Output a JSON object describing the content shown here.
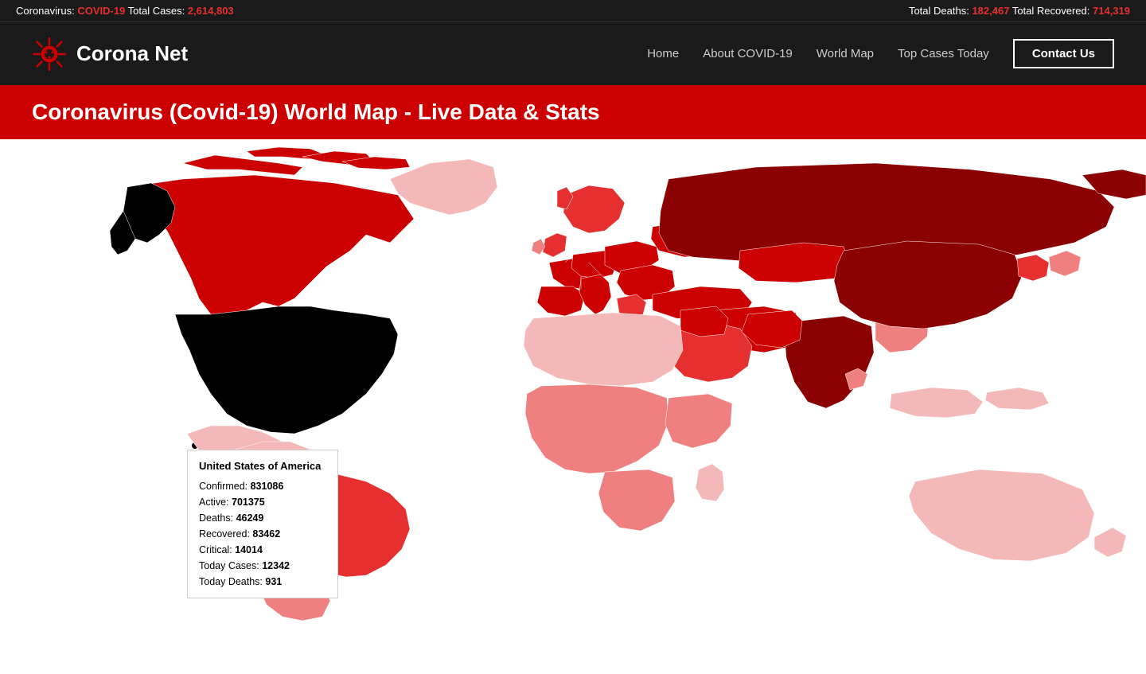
{
  "ticker": {
    "left": "Coronavirus: ",
    "covid_label": "COVID-19",
    "total_cases_label": " Total Cases: ",
    "total_cases_value": "2,614,803",
    "deaths_label": "Total Deaths: ",
    "deaths_value": "182,467",
    "recovered_label": " Total Recovered: ",
    "recovered_value": "714,319"
  },
  "logo": {
    "text": "Corona Net"
  },
  "nav": {
    "home": "Home",
    "about": "About COVID-19",
    "world_map": "World Map",
    "top_cases": "Top Cases Today",
    "contact": "Contact Us"
  },
  "banner": {
    "title": "Coronavirus (Covid-19) World Map - Live Data & Stats"
  },
  "tooltip": {
    "country": "United States of America",
    "confirmed_label": "Confirmed: ",
    "confirmed_value": "831086",
    "active_label": "Active: ",
    "active_value": "701375",
    "deaths_label": "Deaths: ",
    "deaths_value": "46249",
    "recovered_label": "Recovered: ",
    "recovered_value": "83462",
    "critical_label": "Critical: ",
    "critical_value": "14014",
    "today_cases_label": "Today Cases: ",
    "today_cases_value": "12342",
    "today_deaths_label": "Today Deaths: ",
    "today_deaths_value": "931"
  },
  "colors": {
    "dark_red": "#cc0000",
    "medium_red": "#e63030",
    "light_red": "#f08080",
    "very_light_red": "#f5b8b8",
    "black": "#000000",
    "dark_bg": "#1a1a1a"
  }
}
